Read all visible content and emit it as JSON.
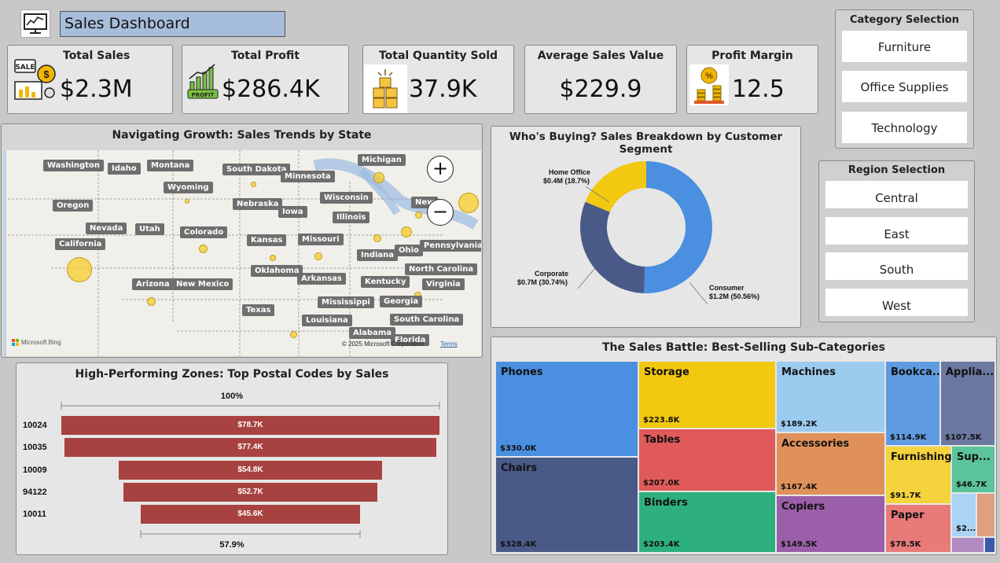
{
  "header": {
    "title": "Sales Dashboard",
    "logo_icon": "monitor-chart-icon"
  },
  "kpis": [
    {
      "label": "Total Sales",
      "value": "$2.3M",
      "icon": "sales-icon"
    },
    {
      "label": "Total Profit",
      "value": "$286.4K",
      "icon": "profit-icon"
    },
    {
      "label": "Total Quantity Sold",
      "value": "37.9K",
      "icon": "boxes-icon"
    },
    {
      "label": "Average Sales Value",
      "value": "$229.9"
    },
    {
      "label": "Profit Margin",
      "value": "12.5",
      "icon": "percent-coins-icon"
    }
  ],
  "category_slicer": {
    "title": "Category Selection",
    "options": [
      "Furniture",
      "Office Supplies",
      "Technology"
    ]
  },
  "region_slicer": {
    "title": "Region Selection",
    "options": [
      "Central",
      "East",
      "South",
      "West"
    ]
  },
  "map": {
    "title": "Navigating Growth: Sales Trends by State",
    "states": [
      "Washington",
      "Idaho",
      "Montana",
      "South Dakota",
      "Michigan",
      "Minnesota",
      "Wyoming",
      "Wisconsin",
      "Oregon",
      "Nebraska",
      "Iowa",
      "Illinois",
      "Nevada",
      "Utah",
      "Colorado",
      "Kansas",
      "Missouri",
      "California",
      "Ohio",
      "Pennsylvania",
      "Indiana",
      "Oklahoma",
      "Arkansas",
      "North Carolina",
      "Arizona",
      "New Mexico",
      "Kentucky",
      "Virginia",
      "Mississippi",
      "Georgia",
      "Texas",
      "Louisiana",
      "South Carolina",
      "Alabama",
      "Florida",
      "New"
    ],
    "attribution": "Microsoft Bing",
    "copyright": "© 2025 Microsoft Corporation",
    "terms": "Terms",
    "zoom_in": "+",
    "zoom_out": "−"
  },
  "segment_chart": {
    "title": "Who's Buying? Sales Breakdown by Customer Segment",
    "labels": [
      {
        "line1": "Consumer",
        "line2": "$1.2M (50.56%)"
      },
      {
        "line1": "Corporate",
        "line2": "$0.7M (30.74%)"
      },
      {
        "line1": "Home Office",
        "line2": "$0.4M (18.7%)"
      }
    ]
  },
  "treemap": {
    "title": "The Sales Battle: Best-Selling Sub-Categories",
    "tiles": [
      {
        "name": "Phones",
        "value": "$330.0K",
        "color": "#4a8fe0"
      },
      {
        "name": "Chairs",
        "value": "$328.4K",
        "color": "#4a5a88"
      },
      {
        "name": "Storage",
        "value": "$223.8K",
        "color": "#f2c811"
      },
      {
        "name": "Tables",
        "value": "$207.0K",
        "color": "#e05a5a"
      },
      {
        "name": "Binders",
        "value": "$203.4K",
        "color": "#2eb07e"
      },
      {
        "name": "Machines",
        "value": "$189.2K",
        "color": "#9ccbf0"
      },
      {
        "name": "Accessories",
        "value": "$167.4K",
        "color": "#e0915a"
      },
      {
        "name": "Copiers",
        "value": "$149.5K",
        "color": "#9b5ea8"
      },
      {
        "name": "Bookca...",
        "value": "$114.9K",
        "color": "#5f9be0"
      },
      {
        "name": "Applia...",
        "value": "$107.5K",
        "color": "#6b78a0"
      },
      {
        "name": "Furnishings",
        "value": "$91.7K",
        "color": "#f5d33c"
      },
      {
        "name": "Sup...",
        "value": "$46.7K",
        "color": "#5cc49a"
      },
      {
        "name": "Paper",
        "value": "$78.5K",
        "color": "#e87a7a"
      },
      {
        "name": "$2...",
        "value": "",
        "color": "#a9d4f5"
      }
    ]
  },
  "funnel": {
    "title": "High-Performing Zones: Top Postal Codes by Sales",
    "top_pct": "100%",
    "bottom_pct": "57.9%",
    "rows": [
      {
        "code": "10024",
        "value": "$78.7K"
      },
      {
        "code": "10035",
        "value": "$77.4K"
      },
      {
        "code": "10009",
        "value": "$54.8K"
      },
      {
        "code": "94122",
        "value": "$52.7K"
      },
      {
        "code": "10011",
        "value": "$45.6K"
      }
    ]
  },
  "chart_data": [
    {
      "type": "pie",
      "title": "Who's Buying? Sales Breakdown by Customer Segment",
      "categories": [
        "Consumer",
        "Corporate",
        "Home Office"
      ],
      "values": [
        50.56,
        30.74,
        18.7
      ],
      "labels": [
        "$1.2M (50.56%)",
        "$0.7M (30.74%)",
        "$0.4M (18.7%)"
      ],
      "colors": [
        "#4a8fe0",
        "#4a5a88",
        "#f2c811"
      ]
    },
    {
      "type": "bar",
      "title": "High-Performing Zones: Top Postal Codes by Sales",
      "categories": [
        "10024",
        "10035",
        "10009",
        "94122",
        "10011"
      ],
      "values": [
        78.7,
        77.4,
        54.8,
        52.7,
        45.6
      ],
      "labels": [
        "$78.7K",
        "$77.4K",
        "$54.8K",
        "$52.7K",
        "$45.6K"
      ]
    }
  ]
}
